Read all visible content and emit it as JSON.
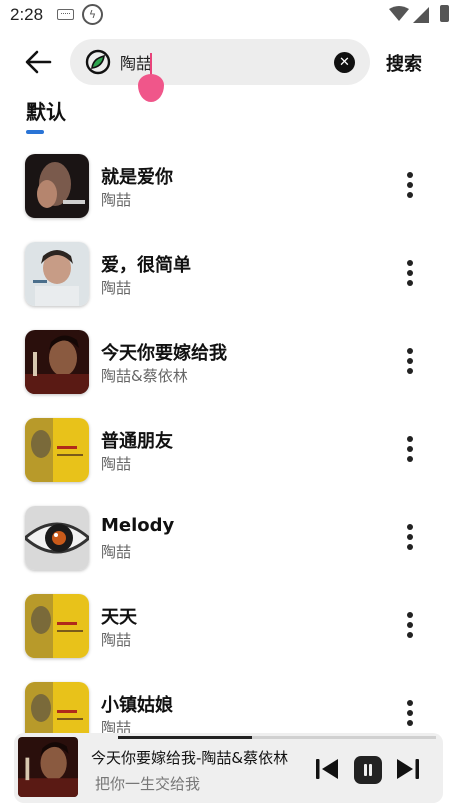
{
  "status_bar": {
    "time": "2:28"
  },
  "search": {
    "value": "陶喆",
    "button_label": "搜索"
  },
  "tabs": [
    {
      "label": "默认",
      "active": true
    }
  ],
  "songs": [
    {
      "title": "就是爱你",
      "artist": "陶喆"
    },
    {
      "title": "爱，很简单",
      "artist": "陶喆"
    },
    {
      "title": "今天你要嫁给我",
      "artist": "陶喆&蔡依林"
    },
    {
      "title": "普通朋友",
      "artist": "陶喆"
    },
    {
      "title": "Melody",
      "artist": "陶喆"
    },
    {
      "title": "天天",
      "artist": "陶喆"
    },
    {
      "title": "小镇姑娘",
      "artist": "陶喆"
    }
  ],
  "now_playing": {
    "title": "今天你要嫁给我-陶喆&蔡依林",
    "lyric": "把你一生交给我",
    "progress": 0.42
  },
  "colors": {
    "accent": "#2a74d6",
    "caret": "#e8437a",
    "handle": "#f0568a"
  }
}
